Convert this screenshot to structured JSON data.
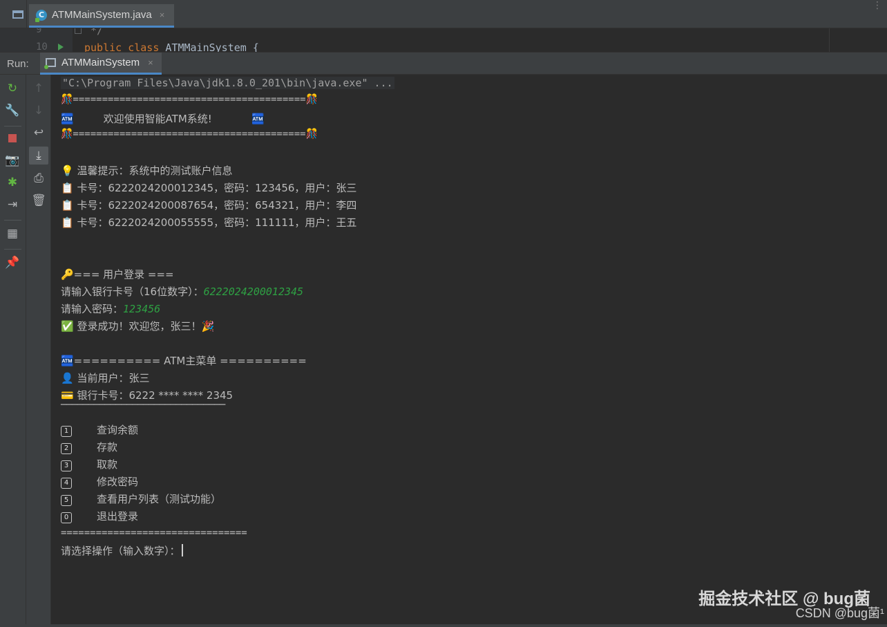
{
  "editor": {
    "tab_label": "ATMMainSystem.java",
    "close_glyph": "×",
    "class_icon_letter": "C",
    "menu_glyph": "⋮",
    "code_lines": [
      {
        "number": "9",
        "text": " */"
      },
      {
        "number": "10",
        "keyword1": "public",
        "keyword2": "class",
        "name": "ATMMainSystem",
        "rest": " {"
      }
    ]
  },
  "run_panel": {
    "label": "Run:",
    "tab_label": "ATMMainSystem",
    "close_glyph": "×"
  },
  "console": {
    "command": "\"C:\\Program Files\\Java\\jdk1.8.0_201\\bin\\java.exe\" ...",
    "banner_top": "🎊========================================🎊",
    "banner_title": "🏧         欢迎使用智能ATM系统!            🏧",
    "banner_bottom": "🎊========================================🎊",
    "tip": "💡 温馨提示：系统中的测试账户信息",
    "accounts": [
      "📋 卡号：6222024200012345，密码：123456，用户：张三",
      "📋 卡号：6222024200087654，密码：654321，用户：李四",
      "📋 卡号：6222024200055555，密码：111111，用户：王五"
    ],
    "login_header": "🔑=== 用户登录 ===",
    "card_prompt": "请输入银行卡号（16位数字）：",
    "card_input": "6222024200012345",
    "pwd_prompt": "请输入密码：",
    "pwd_input": "123456",
    "login_success": "✅ 登录成功！欢迎您，张三！🎉",
    "menu_header": "🏧========== ATM主菜单 ==========",
    "current_user": "👤 当前用户：张三",
    "card_number": "💳 银行卡号：6222 **** **** 2345",
    "divider": "──────────────────────────────",
    "menu_items": [
      {
        "key": "1",
        "label": "查询余额"
      },
      {
        "key": "2",
        "label": "存款"
      },
      {
        "key": "3",
        "label": "取款"
      },
      {
        "key": "4",
        "label": "修改密码"
      },
      {
        "key": "5",
        "label": "查看用户列表（测试功能）"
      },
      {
        "key": "0",
        "label": "退出登录"
      }
    ],
    "menu_footer": "================================",
    "choice_prompt": "请选择操作（输入数字）："
  },
  "watermark": {
    "line1": "掘金技术社区 @ bug菌",
    "line2": "CSDN @bug菌¹"
  },
  "colors": {
    "background": "#2b2b2b",
    "toolbar": "#3c3f41",
    "user_input": "#2ea043",
    "keyword": "#cc7832",
    "accent": "#4a88c7"
  }
}
